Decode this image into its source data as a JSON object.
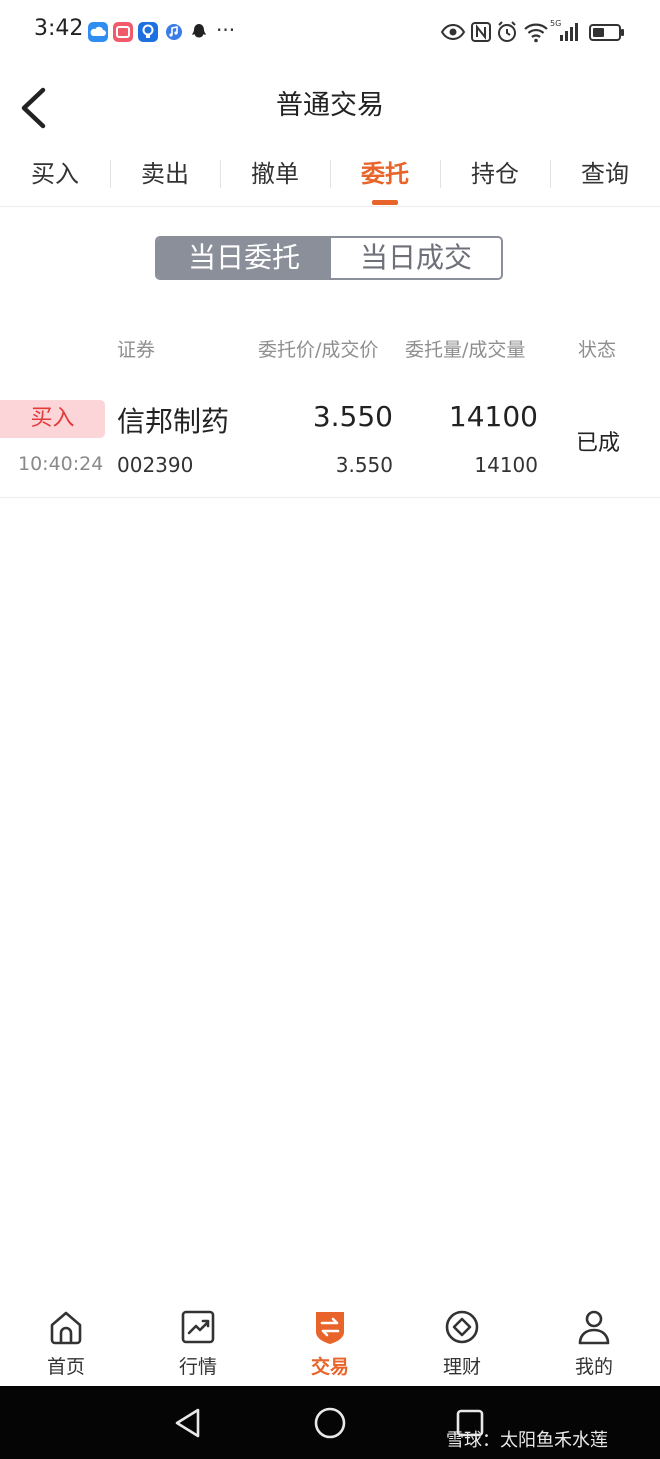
{
  "status_bar": {
    "time": "3:42",
    "overflow": "···",
    "network_badge": "5G",
    "icons": [
      "cloud-icon",
      "app-icon",
      "bulb-icon",
      "music-icon",
      "qq-icon",
      "eye-icon",
      "nfc-icon",
      "alarm-icon",
      "wifi-icon",
      "signal-icon",
      "battery-icon"
    ]
  },
  "header": {
    "title": "普通交易",
    "back_icon": "chevron-left-icon"
  },
  "tabs": [
    {
      "label": "买入"
    },
    {
      "label": "卖出"
    },
    {
      "label": "撤单"
    },
    {
      "label": "委托",
      "active": true
    },
    {
      "label": "持仓"
    },
    {
      "label": "查询"
    }
  ],
  "segment": {
    "options": [
      "当日委托",
      "当日成交"
    ],
    "selected": "当日委托"
  },
  "table": {
    "headers": {
      "security": "证券",
      "price": "委托价/成交价",
      "qty": "委托量/成交量",
      "status": "状态"
    },
    "rows": [
      {
        "side": "买入",
        "time": "10:40:24",
        "name": "信邦制药",
        "code": "002390",
        "order_price": "3.550",
        "deal_price": "3.550",
        "order_qty": "14100",
        "deal_qty": "14100",
        "status": "已成"
      }
    ]
  },
  "bottom_nav": {
    "items": [
      {
        "label": "首页",
        "icon": "home-icon"
      },
      {
        "label": "行情",
        "icon": "chart-icon"
      },
      {
        "label": "交易",
        "icon": "trade-icon",
        "active": true
      },
      {
        "label": "理财",
        "icon": "finance-icon"
      },
      {
        "label": "我的",
        "icon": "profile-icon"
      }
    ]
  },
  "system_nav": {
    "icons": [
      "back-triangle-icon",
      "home-circle-icon",
      "recents-square-icon"
    ]
  },
  "watermark": "雪球：太阳鱼禾水莲",
  "colors": {
    "accent": "#e8642a",
    "buy_tag_bg": "#fbd5d8",
    "buy_tag_text": "#e23b3b",
    "segment_gray": "#8b8f99"
  }
}
